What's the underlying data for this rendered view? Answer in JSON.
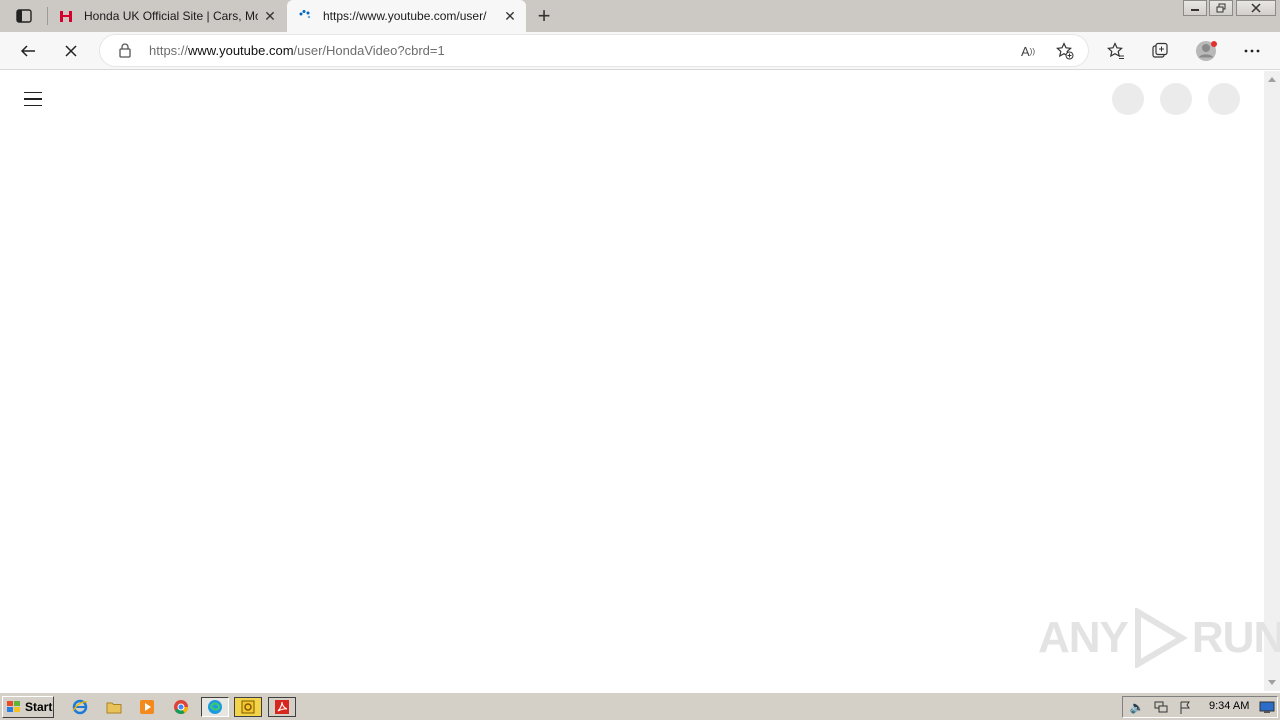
{
  "browser": {
    "tabs": [
      {
        "title": "Honda UK Official Site | Cars, Mo",
        "favicon": "honda-h-icon",
        "state": "inactive"
      },
      {
        "title": "https://www.youtube.com/user/",
        "favicon": "loading-spinner-icon",
        "state": "active"
      }
    ],
    "new_tab_label": "+",
    "address": {
      "scheme": "https://",
      "host": "www.youtube.com",
      "path": "/user/HondaVideo?cbrd=1"
    },
    "read_aloud_label": "A",
    "accent_color": "#0067c0"
  },
  "page": {
    "placeholder_color": "#ebebeb"
  },
  "watermark": {
    "left": "ANY",
    "right": "RUN"
  },
  "taskbar": {
    "start_label": "Start",
    "clock": "9:34 AM"
  }
}
